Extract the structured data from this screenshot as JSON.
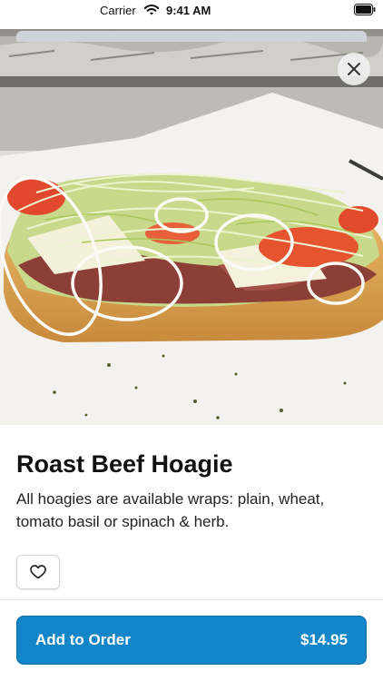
{
  "status_bar": {
    "carrier": "Carrier",
    "time": "9:41 AM"
  },
  "icons": {
    "wifi": "wifi-icon",
    "battery": "battery-icon",
    "close": "close-icon",
    "heart": "heart-icon"
  },
  "item": {
    "name": "Roast Beef Hoagie",
    "description": "All hoagies are available wraps: plain, wheat, tomato basil or spinach & herb."
  },
  "actions": {
    "add_label": "Add to Order",
    "price": "$14.95"
  },
  "colors": {
    "accent": "#1385c9"
  }
}
